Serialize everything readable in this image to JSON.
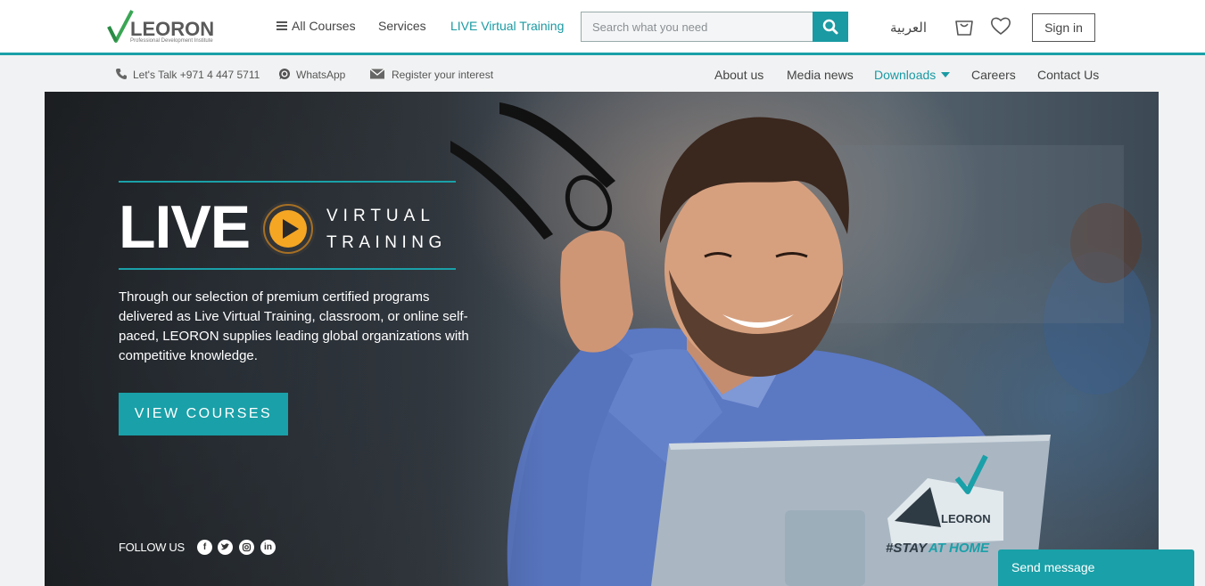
{
  "header": {
    "logo_text": "LEORON",
    "logo_sub": "Professional Development Institute",
    "nav": {
      "all_courses": "All Courses",
      "services": "Services",
      "live_virtual": "LIVE Virtual Training"
    },
    "search": {
      "placeholder": "Search what you need"
    },
    "language": "العربية",
    "sign_in": "Sign in"
  },
  "subbar": {
    "phone": "Let's Talk +971 4 447 5711",
    "whatsapp": "WhatsApp",
    "register": "Register your interest",
    "links": {
      "about": "About us",
      "media": "Media news",
      "downloads": "Downloads",
      "careers": "Careers",
      "contact": "Contact Us"
    }
  },
  "hero": {
    "live": "LIVE",
    "virtual": "VIRTUAL",
    "training": "TRAINING",
    "description": "Through our selection of premium certified programs delivered as Live Virtual Training, classroom, or online self-paced, LEORON supplies leading global organizations with competitive knowledge.",
    "cta": "VIEW COURSES",
    "follow_us": "FOLLOW US",
    "badge_brand": "LEORON",
    "badge_hashtag": "#STAY",
    "badge_hashtag2": "AT HOME"
  },
  "chat": {
    "send_message": "Send message"
  },
  "colors": {
    "accent": "#1aa0a8",
    "play": "#f5a623"
  }
}
